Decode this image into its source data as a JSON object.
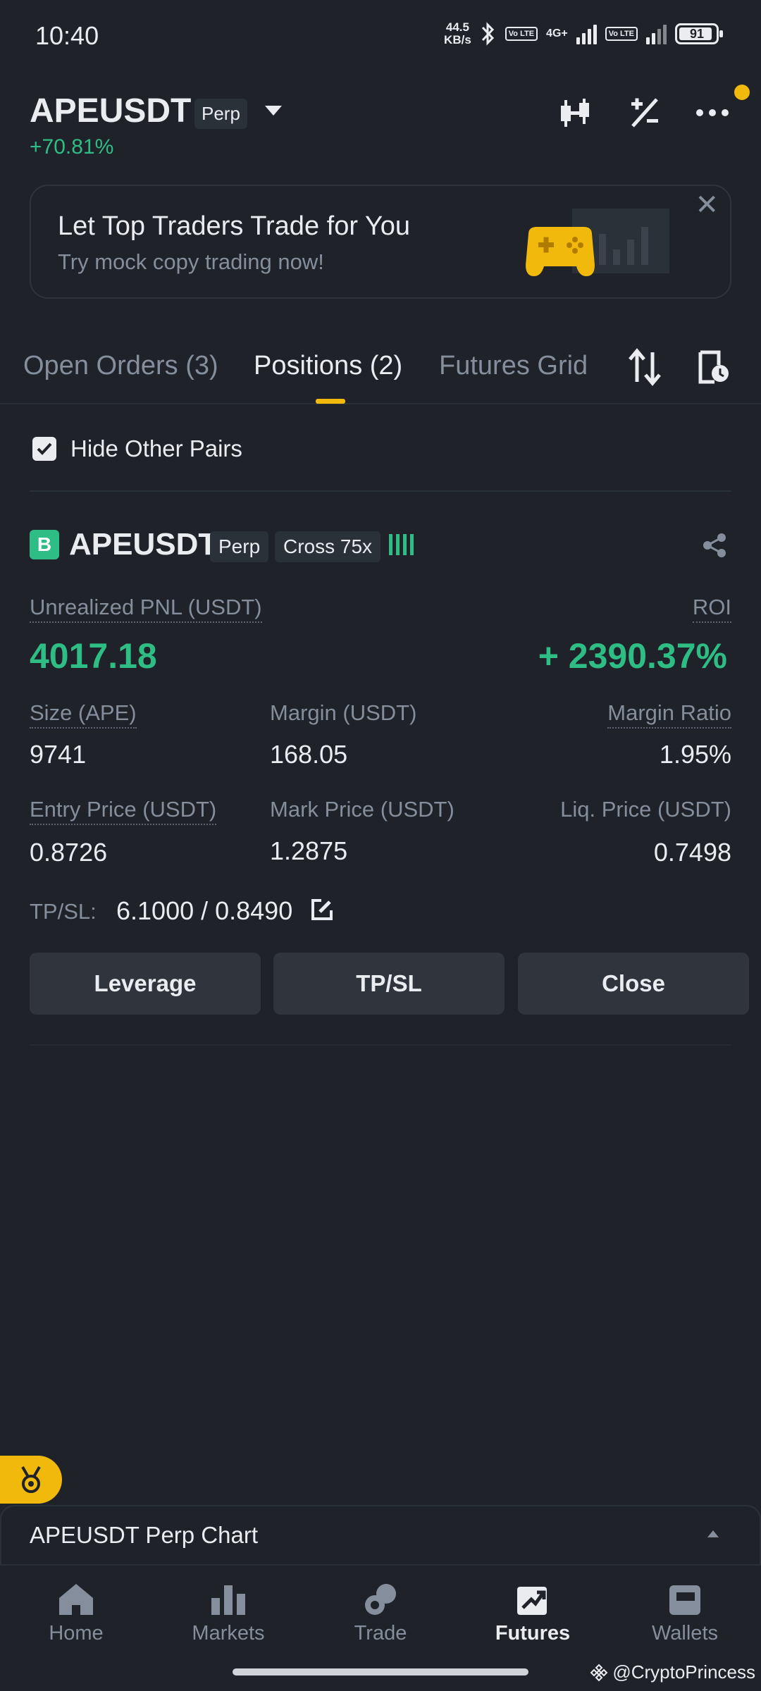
{
  "status_bar": {
    "time": "10:40",
    "net_speed_value": "44.5",
    "net_speed_unit": "KB/s",
    "volte1": "Vo LTE",
    "network": "4G+",
    "volte2": "Vo LTE",
    "battery": "91"
  },
  "header": {
    "symbol": "APEUSDT",
    "contract_type": "Perp",
    "change": "+70.81%"
  },
  "banner": {
    "title": "Let Top Traders Trade for You",
    "subtitle": "Try mock copy trading now!",
    "close": "✕"
  },
  "tabs": {
    "open_orders": "Open Orders (3)",
    "positions": "Positions (2)",
    "futures_grid": "Futures Grid"
  },
  "filter": {
    "hide_other_pairs": "Hide Other Pairs"
  },
  "position": {
    "side_badge": "B",
    "symbol": "APEUSDT",
    "contract_type": "Perp",
    "margin_mode": "Cross 75x",
    "unrealized_pnl_label": "Unrealized PNL (USDT)",
    "unrealized_pnl": "4017.18",
    "roi_label": "ROI",
    "roi": "+ 2390.37%",
    "size_label": "Size (APE)",
    "size": "9741",
    "margin_label": "Margin (USDT)",
    "margin": "168.05",
    "margin_ratio_label": "Margin Ratio",
    "margin_ratio": "1.95%",
    "entry_price_label": "Entry Price (USDT)",
    "entry_price": "0.8726",
    "mark_price_label": "Mark Price (USDT)",
    "mark_price": "1.2875",
    "liq_price_label": "Liq. Price (USDT)",
    "liq_price": "0.7498",
    "tpsl_label": "TP/SL:",
    "tpsl_value": "6.1000 / 0.8490",
    "buttons": {
      "leverage": "Leverage",
      "tpsl": "TP/SL",
      "close": "Close"
    }
  },
  "chart_panel": {
    "label": "APEUSDT Perp Chart"
  },
  "bottom_nav": [
    {
      "label": "Home",
      "icon": "home-icon"
    },
    {
      "label": "Markets",
      "icon": "markets-icon"
    },
    {
      "label": "Trade",
      "icon": "trade-icon"
    },
    {
      "label": "Futures",
      "icon": "futures-icon",
      "active": true
    },
    {
      "label": "Wallets",
      "icon": "wallet-icon"
    }
  ],
  "watermark": "@CryptoPrincess",
  "colors": {
    "accent": "#f0b90b",
    "positive": "#2ebd85",
    "background": "#1f2229",
    "muted": "#848e9c"
  }
}
